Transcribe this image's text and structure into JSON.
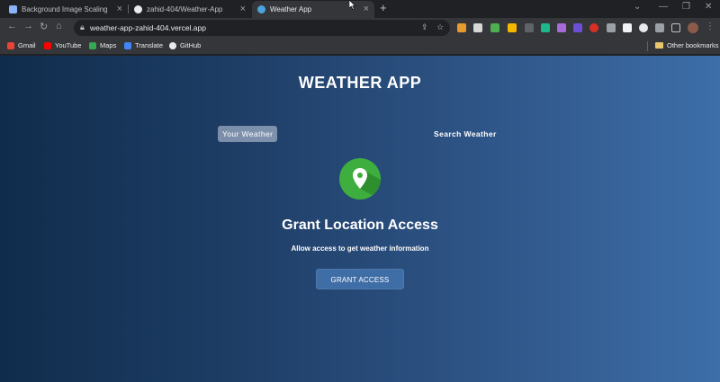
{
  "browser": {
    "tabs": [
      {
        "title": "Background Image Scaling",
        "favicon_color": "#8ab4f8"
      },
      {
        "title": "zahid-404/Weather-App",
        "favicon_color": "#e8eaed"
      },
      {
        "title": "Weather App",
        "favicon_color": "#4aa3df"
      }
    ],
    "new_tab_icon": "plus-icon",
    "url": "weather-app-zahid-404.vercel.app",
    "bookmarks": [
      {
        "label": "Gmail",
        "color": "#ea4335"
      },
      {
        "label": "YouTube",
        "color": "#ff0000"
      },
      {
        "label": "Maps",
        "color": "#34a853"
      },
      {
        "label": "Translate",
        "color": "#4285f4"
      },
      {
        "label": "GitHub",
        "color": "#e8eaed"
      }
    ],
    "other_bookmarks": "Other bookmarks"
  },
  "app": {
    "title": "WEATHER APP",
    "tabs": {
      "current": "Your Weather",
      "other": "Search Weather"
    },
    "grant": {
      "heading": "Grant Location Access",
      "subtext": "Allow access to get weather information",
      "button": "GRANT ACCESS",
      "icon": "location-pin-icon"
    },
    "colors": {
      "icon_bg": "#3eae3e",
      "button_bg": "#3f6ea6",
      "gradient_start": "#102c4c",
      "gradient_end": "#3d6ea8"
    }
  }
}
